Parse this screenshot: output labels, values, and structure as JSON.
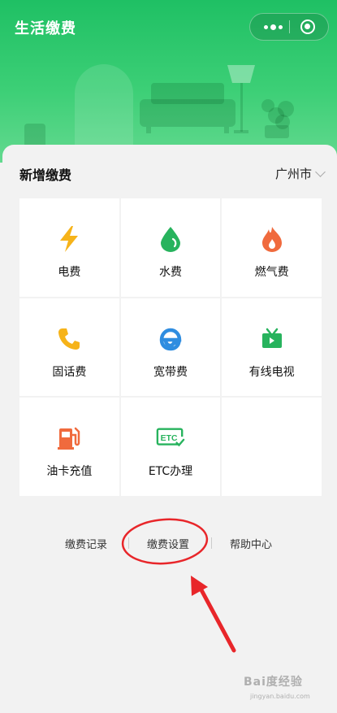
{
  "header": {
    "title": "生活缴费",
    "menu_icon": "more-dots-icon",
    "close_icon": "target-close-icon"
  },
  "panel": {
    "section_title": "新增缴费",
    "city": "广州市"
  },
  "services": [
    {
      "label": "电费",
      "icon": "lightning-icon",
      "color": "#f6b319"
    },
    {
      "label": "水费",
      "icon": "water-drop-icon",
      "color": "#27b35d"
    },
    {
      "label": "燃气费",
      "icon": "flame-icon",
      "color": "#f06a3d"
    },
    {
      "label": "固话费",
      "icon": "phone-icon",
      "color": "#f6b319"
    },
    {
      "label": "宽带费",
      "icon": "ie-browser-icon",
      "color": "#2f8de0"
    },
    {
      "label": "有线电视",
      "icon": "tv-icon",
      "color": "#27b35d"
    },
    {
      "label": "油卡充值",
      "icon": "gas-pump-icon",
      "color": "#f06a3d"
    },
    {
      "label": "ETC办理",
      "icon": "etc-icon",
      "color": "#27b35d"
    }
  ],
  "bottom_links": {
    "records": "缴费记录",
    "settings": "缴费设置",
    "help": "帮助中心"
  },
  "watermark": {
    "text": "Bai度经验",
    "sub": "jingyan.baidu.com"
  },
  "colors": {
    "brand_green": "#1fc064",
    "annotation_red": "#e8262a"
  }
}
